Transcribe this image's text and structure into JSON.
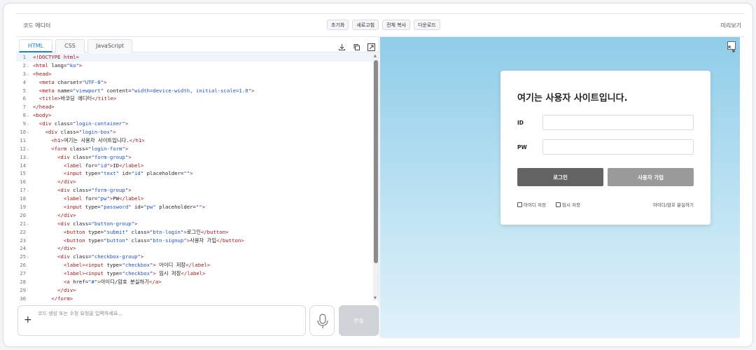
{
  "topbar": {
    "title": "코드 에디터",
    "toolbar": [
      "초기화",
      "새로고침",
      "전체 복사",
      "다운로드"
    ],
    "preview_label": "미리보기"
  },
  "tabs": [
    "HTML",
    "CSS",
    "JavaScript"
  ],
  "code_lines": [
    {
      "n": "1",
      "fold": "",
      "html": "<span class=\"tg\">&lt;!DOCTYPE html&gt;</span>"
    },
    {
      "n": "2",
      "fold": "⌄",
      "html": "<span class=\"tg\">&lt;html</span> <span class=\"at\">lang=</span><span class=\"vl\">\"ko\"</span><span class=\"tg\">&gt;</span>"
    },
    {
      "n": "3",
      "fold": "⌄",
      "html": "<span class=\"tg\">&lt;head&gt;</span>"
    },
    {
      "n": "4",
      "fold": "",
      "html": "  <span class=\"tg\">&lt;meta</span> <span class=\"at\">charset=</span><span class=\"vl\">\"UTF-8\"</span><span class=\"tg\">&gt;</span>"
    },
    {
      "n": "5",
      "fold": "",
      "html": "  <span class=\"tg\">&lt;meta</span> <span class=\"at\">name=</span><span class=\"vl\">\"viewport\"</span> <span class=\"at\">content=</span><span class=\"vl\">\"width=device-width, initial-scale=1.0\"</span><span class=\"tg\">&gt;</span>"
    },
    {
      "n": "6",
      "fold": "",
      "html": "  <span class=\"tg\">&lt;title&gt;</span>바코딩 에디터<span class=\"tg\">&lt;/title&gt;</span>"
    },
    {
      "n": "7",
      "fold": "",
      "html": "<span class=\"tg\">&lt;/head&gt;</span>"
    },
    {
      "n": "8",
      "fold": "⌄",
      "html": "<span class=\"tg\">&lt;body&gt;</span>"
    },
    {
      "n": "9",
      "fold": "⌄",
      "html": "  <span class=\"tg\">&lt;div</span> <span class=\"at\">class=</span><span class=\"vl\">\"login-container\"</span><span class=\"tg\">&gt;</span>"
    },
    {
      "n": "10",
      "fold": "⌄",
      "html": "    <span class=\"tg\">&lt;div</span> <span class=\"at\">class=</span><span class=\"vl\">\"login-box\"</span><span class=\"tg\">&gt;</span>"
    },
    {
      "n": "11",
      "fold": "",
      "html": "      <span class=\"tg\">&lt;h1&gt;</span>여기는 사용자 사이트입니다.<span class=\"tg\">&lt;/h1&gt;</span>"
    },
    {
      "n": "12",
      "fold": "⌄",
      "html": "      <span class=\"tg\">&lt;form</span> <span class=\"at\">class=</span><span class=\"vl\">\"login-form\"</span><span class=\"tg\">&gt;</span>"
    },
    {
      "n": "13",
      "fold": "⌄",
      "html": "        <span class=\"tg\">&lt;div</span> <span class=\"at\">class=</span><span class=\"vl\">\"form-group\"</span><span class=\"tg\">&gt;</span>"
    },
    {
      "n": "14",
      "fold": "",
      "html": "          <span class=\"tg\">&lt;label</span> <span class=\"at\">for=</span><span class=\"vl\">\"id\"</span><span class=\"tg\">&gt;</span>ID<span class=\"tg\">&lt;/label&gt;</span>"
    },
    {
      "n": "15",
      "fold": "",
      "html": "          <span class=\"tg\">&lt;input</span> <span class=\"at\">type=</span><span class=\"vl\">\"text\"</span> <span class=\"at\">id=</span><span class=\"vl\">\"id\"</span> <span class=\"at\">placeholder=</span><span class=\"vl\">\"\"</span><span class=\"tg\">&gt;</span>"
    },
    {
      "n": "16",
      "fold": "",
      "html": "        <span class=\"tg\">&lt;/div&gt;</span>"
    },
    {
      "n": "17",
      "fold": "⌄",
      "html": "        <span class=\"tg\">&lt;div</span> <span class=\"at\">class=</span><span class=\"vl\">\"form-group\"</span><span class=\"tg\">&gt;</span>"
    },
    {
      "n": "18",
      "fold": "",
      "html": "          <span class=\"tg\">&lt;label</span> <span class=\"at\">for=</span><span class=\"vl\">\"pw\"</span><span class=\"tg\">&gt;</span>PW<span class=\"tg\">&lt;/label&gt;</span>"
    },
    {
      "n": "19",
      "fold": "",
      "html": "          <span class=\"tg\">&lt;input</span> <span class=\"at\">type=</span><span class=\"vl\">\"password\"</span> <span class=\"at\">id=</span><span class=\"vl\">\"pw\"</span> <span class=\"at\">placeholder=</span><span class=\"vl\">\"\"</span><span class=\"tg\">&gt;</span>"
    },
    {
      "n": "20",
      "fold": "",
      "html": "        <span class=\"tg\">&lt;/div&gt;</span>"
    },
    {
      "n": "21",
      "fold": "⌄",
      "html": "        <span class=\"tg\">&lt;div</span> <span class=\"at\">class=</span><span class=\"vl\">\"button-group\"</span><span class=\"tg\">&gt;</span>"
    },
    {
      "n": "22",
      "fold": "",
      "html": "          <span class=\"tg\">&lt;button</span> <span class=\"at\">type=</span><span class=\"vl\">\"submit\"</span> <span class=\"at\">class=</span><span class=\"vl\">\"btn-login\"</span><span class=\"tg\">&gt;</span>로그인<span class=\"tg\">&lt;/button&gt;</span>"
    },
    {
      "n": "23",
      "fold": "",
      "html": "          <span class=\"tg\">&lt;button</span> <span class=\"at\">type=</span><span class=\"vl\">\"button\"</span> <span class=\"at\">class=</span><span class=\"vl\">\"btn-signup\"</span><span class=\"tg\">&gt;</span>사용자 가입<span class=\"tg\">&lt;/button&gt;</span>"
    },
    {
      "n": "24",
      "fold": "",
      "html": "        <span class=\"tg\">&lt;/div&gt;</span>"
    },
    {
      "n": "25",
      "fold": "⌄",
      "html": "        <span class=\"tg\">&lt;div</span> <span class=\"at\">class=</span><span class=\"vl\">\"checkbox-group\"</span><span class=\"tg\">&gt;</span>"
    },
    {
      "n": "26",
      "fold": "",
      "html": "          <span class=\"tg\">&lt;label&gt;&lt;input</span> <span class=\"at\">type=</span><span class=\"vl\">\"checkbox\"</span><span class=\"tg\">&gt;</span> 아이디 저장<span class=\"tg\">&lt;/label&gt;</span>"
    },
    {
      "n": "27",
      "fold": "",
      "html": "          <span class=\"tg\">&lt;label&gt;&lt;input</span> <span class=\"at\">type=</span><span class=\"vl\">\"checkbox\"</span><span class=\"tg\">&gt;</span> 임시 저장<span class=\"tg\">&lt;/label&gt;</span>"
    },
    {
      "n": "28",
      "fold": "",
      "html": "          <span class=\"tg\">&lt;a</span> <span class=\"at\">href=</span><span class=\"vl\">\"#\"</span><span class=\"tg\">&gt;</span>아이디/암호 분실하기<span class=\"tg\">&lt;/a&gt;</span>"
    },
    {
      "n": "29",
      "fold": "",
      "html": "        <span class=\"tg\">&lt;/div&gt;</span>"
    },
    {
      "n": "30",
      "fold": "",
      "html": "      <span class=\"tg\">&lt;/form&gt;</span>"
    }
  ],
  "prompt": {
    "placeholder": "코드 생성 또는 수정 요청을 입력하세요...",
    "send_label": "전송"
  },
  "preview_card": {
    "heading": "여기는 사용자 사이트입니다.",
    "id_label": "ID",
    "pw_label": "PW",
    "login_label": "로그인",
    "signup_label": "사용자 가입",
    "save_id_label": "아이디 저장",
    "temp_save_label": "임시 저장",
    "forgot_label": "아이디/암호 분실하기"
  },
  "colors": {
    "accent": "#1d7bd8",
    "login_button": "#636363",
    "signup_button": "#9a9a9a",
    "preview_bg_top": "#8fcde9"
  }
}
